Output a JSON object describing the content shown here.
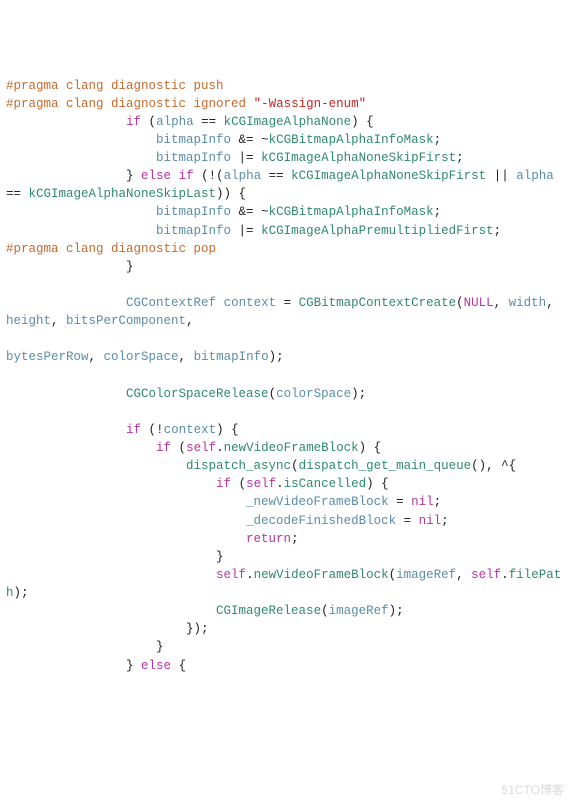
{
  "watermark": "51CTO博客",
  "lines": {
    "l1_pragma": "#pragma",
    "l1_rest": " clang diagnostic push",
    "l2_pragma": "#pragma",
    "l2_rest": " clang diagnostic ignored ",
    "l2_str": "\"-Wassign-enum\"",
    "l3_indent": "                ",
    "l3_if": "if",
    "l3_sp": " (",
    "l3_alpha": "alpha",
    "l3_eq": " == ",
    "l3_enum": "kCGImageAlphaNone",
    "l3_end": ") {",
    "l4_indent": "                    ",
    "l4_bi": "bitmapInfo",
    "l4_op": " &= ~",
    "l4_enum": "kCGBitmapAlphaInfoMask",
    "l4_semi": ";",
    "l5_indent": "                    ",
    "l5_bi": "bitmapInfo",
    "l5_op": " |= ",
    "l5_enum": "kCGImageAlphaNoneSkipFirst",
    "l5_semi": ";",
    "l6_indent": "                } ",
    "l6_else": "else",
    "l6_sp": " ",
    "l6_if": "if",
    "l6_rest1": " (!(",
    "l6_alpha": "alpha",
    "l6_eq": " == ",
    "l6_enum1": "kCGImageAlphaNoneSkipFirst",
    "l6_or": " || ",
    "l6b_alpha": "alpha",
    "l6b_eq": " == ",
    "l6b_enum": "kCGImageAlphaNoneSkipLast",
    "l6b_end": ")) {",
    "l7_indent": "                    ",
    "l7_bi": "bitmapInfo",
    "l7_op": " &= ~",
    "l7_enum": "kCGBitmapAlphaInfoMask",
    "l7_semi": ";",
    "l8_indent": "                    ",
    "l8_bi": "bitmapInfo",
    "l8_op": " |= ",
    "l8_enum": "kCGImageAlphaPremultipliedFirst",
    "l8_semi": ";",
    "l9_pragma": "#pragma",
    "l9_rest": " clang diagnostic pop",
    "l10": "                }",
    "blank": "",
    "l11_indent": "                ",
    "l11_type": "CGContextRef",
    "l11_sp": " ",
    "l11_ctx": "context",
    "l11_eq": " = ",
    "l11_fn": "CGBitmapContextCreate",
    "l11_open": "(",
    "l11_null": "NULL",
    "l11_comma": ", ",
    "l11b_w": "width",
    "l11b_c1": ", ",
    "l11b_h": "height",
    "l11b_c2": ", ",
    "l11b_bpc": "bitsPerComponent",
    "l11b_c3": ",",
    "l11c_bpr": "bytesPerRow",
    "l11c_c1": ", ",
    "l11c_cs": "colorSpace",
    "l11c_c2": ", ",
    "l11c_bi": "bitmapInfo",
    "l11c_end": ");",
    "l12_indent": "                ",
    "l12_fn": "CGColorSpaceRelease",
    "l12_open": "(",
    "l12_arg": "colorSpace",
    "l12_end": ");",
    "l13_indent": "                ",
    "l13_if": "if",
    "l13_rest": " (!",
    "l13_ctx": "context",
    "l13_end": ") {",
    "l14_indent": "                    ",
    "l14_if": "if",
    "l14_rest": " (",
    "l14_self": "self",
    "l14_dot": ".",
    "l14_prop": "newVideoFrameBlock",
    "l14_end": ") {",
    "l15_indent": "                        ",
    "l15_fn": "dispatch_async",
    "l15_open": "(",
    "l15_q": "dispatch_get_main_queue",
    "l15_mid": "(), ",
    "l15_caret": "^",
    "l15_brace": "{",
    "l16_indent": "                            ",
    "l16_if": "if",
    "l16_rest": " (",
    "l16_self": "self",
    "l16_dot": ".",
    "l16_prop": "isCancelled",
    "l16_end": ") {",
    "l17_indent": "                                ",
    "l17_var": "_newVideoFrameBlock",
    "l17_eq": " = ",
    "l17_nil": "nil",
    "l17_semi": ";",
    "l18_indent": "                                ",
    "l18_var": "_decodeFinishedBlock",
    "l18_eq": " = ",
    "l18_nil": "nil",
    "l18_semi": ";",
    "l19_indent": "                                ",
    "l19_ret": "return",
    "l19_semi": ";",
    "l20": "                            }",
    "l21_indent": "                            ",
    "l21_self": "self",
    "l21_dot": ".",
    "l21_prop": "newVideoFrameBlock",
    "l21_open": "(",
    "l21_arg1": "imageRef",
    "l21_c": ", ",
    "l21_self2": "self",
    "l21_dot2": ".",
    "l21_prop2": "fileP",
    "l21b_rest": "ath",
    "l21b_end": ");",
    "l22_indent": "                            ",
    "l22_fn": "CGImageRelease",
    "l22_open": "(",
    "l22_arg": "imageRef",
    "l22_end": ");",
    "l23": "                        });",
    "l24": "                    }",
    "l25_indent": "                } ",
    "l25_else": "else",
    "l25_end": " {"
  }
}
